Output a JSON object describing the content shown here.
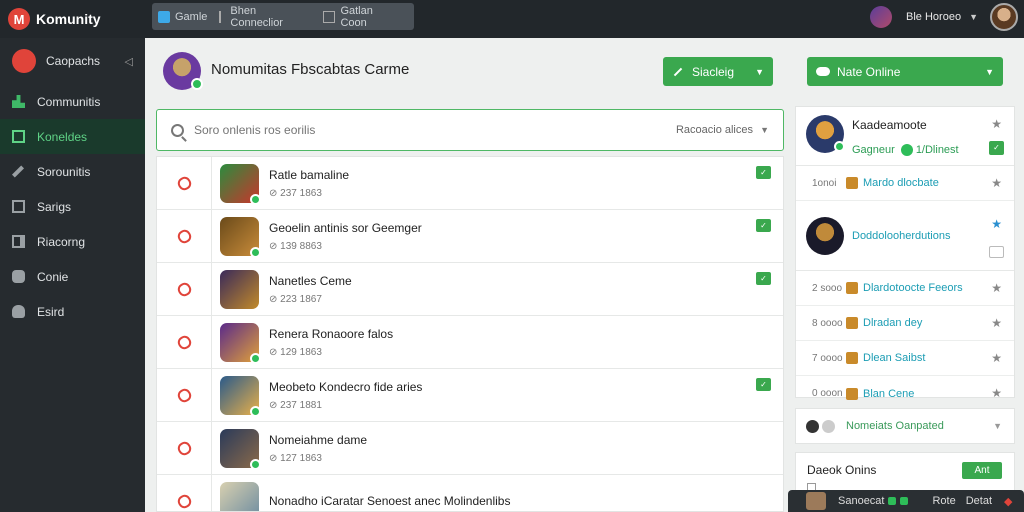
{
  "app": {
    "name": "Komunity",
    "logo_letter": "M"
  },
  "top_tabs": [
    {
      "label": "Gamle",
      "active": true
    },
    {
      "label": "Bhen Conneclior",
      "active": false
    },
    {
      "label": "Gatlan Coon",
      "active": false
    }
  ],
  "user": {
    "name": "Ble Horoeo"
  },
  "sidebar": {
    "header": "Caopachs",
    "items": [
      {
        "label": "Communitis",
        "icon": "bar-chart-icon",
        "active": false
      },
      {
        "label": "Koneldes",
        "icon": "grid-icon",
        "active": true
      },
      {
        "label": "Sorounitis",
        "icon": "pencil-icon",
        "active": false
      },
      {
        "label": "Sarigs",
        "icon": "image-icon",
        "active": false
      },
      {
        "label": "Riacorng",
        "icon": "frame-icon",
        "active": false
      },
      {
        "label": "Conie",
        "icon": "gamepad-icon",
        "active": false
      },
      {
        "label": "Esird",
        "icon": "cloud-icon",
        "active": false
      }
    ]
  },
  "main": {
    "title": "Nomumitas Fbscabtas Carme",
    "settings_label": "Siacleig",
    "search": {
      "placeholder": "Soro onlenis ros eorilis",
      "filter_label": "Racoacio alices"
    },
    "rows": [
      {
        "title": "Ratle bamaline",
        "meta": "237 1863",
        "checked": true,
        "colors": [
          "#2b8c3e",
          "#c8362c"
        ]
      },
      {
        "title": "Geoelin antinis sor Geemger",
        "meta": "139 8863",
        "checked": true,
        "colors": [
          "#6a4a1a",
          "#c98c3a"
        ]
      },
      {
        "title": "Nanetles Ceme",
        "meta": "223 1867",
        "checked": true,
        "colors": [
          "#3a2a5a",
          "#c28a2a"
        ]
      },
      {
        "title": "Renera Ronaoore falos",
        "meta": "129 1863",
        "checked": false,
        "colors": [
          "#5a2a8a",
          "#e0a03a"
        ]
      },
      {
        "title": "Meobeto Kondecro fide aries",
        "meta": "237 1881",
        "checked": true,
        "colors": [
          "#2a5a8a",
          "#e8b04a"
        ]
      },
      {
        "title": "Nomeiahme dame",
        "meta": "127 1863",
        "checked": false,
        "colors": [
          "#2a3a5a",
          "#8a6a4a"
        ]
      },
      {
        "title": "Nonadho iCaratar Senoest anec Molindenlibs",
        "meta": "",
        "checked": false,
        "colors": [
          "#d8d0b0",
          "#6a8aa0"
        ]
      }
    ]
  },
  "right": {
    "online_label": "Nate Online",
    "featured": {
      "name": "Kaadeamoote",
      "sub_label": "Gagneur",
      "sub_status": "1/Dlinest"
    },
    "members": [
      {
        "time": "1onoi",
        "name": "Mardo dlocbate"
      },
      {
        "featured": true,
        "name": "Doddolooherdutions"
      },
      {
        "time": "2 sooo",
        "name": "Dlardotoocte Feeors"
      },
      {
        "time": "8 oooo",
        "name": "Dlradan dey"
      },
      {
        "time": "7 oooo",
        "name": "Dlean Saibst"
      },
      {
        "time": "0 ooon",
        "name": "Blan Cene"
      }
    ],
    "group_label": "Nomeiats Oanpated",
    "desc_label": "Daeok Onins",
    "add_label": "Ant"
  },
  "chat": {
    "label": "Sanoecat",
    "vote_label": "Rote",
    "action_label": "Detat"
  }
}
